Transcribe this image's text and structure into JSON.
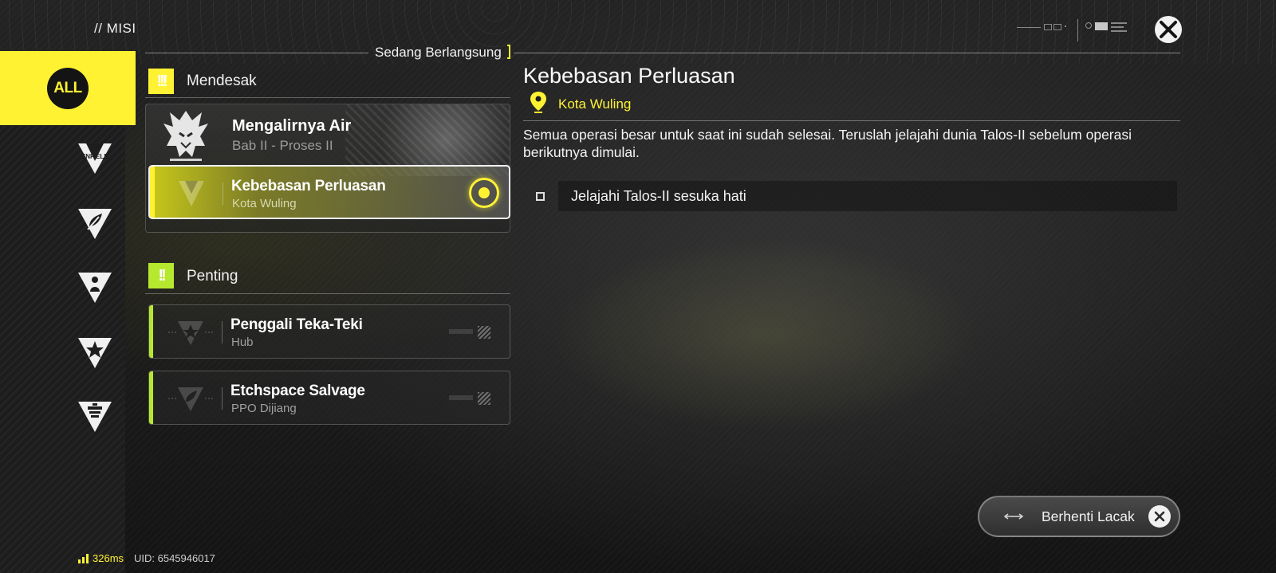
{
  "header": {
    "title": "// MISI",
    "close_icon": "close-x-icon"
  },
  "sidebar": {
    "items": [
      {
        "name": "all",
        "label": "ALL",
        "active": true
      },
      {
        "name": "enfield",
        "label": "ENFIELD",
        "icon": "enfield-v-icon"
      },
      {
        "name": "leaf",
        "icon": "leaf-triangle-icon"
      },
      {
        "name": "person",
        "icon": "person-triangle-icon"
      },
      {
        "name": "star",
        "icon": "star-triangle-icon"
      },
      {
        "name": "list",
        "icon": "list-triangle-icon"
      }
    ]
  },
  "tab": {
    "label": "Sedang Berlangsung"
  },
  "groups": [
    {
      "title": "Mendesak",
      "badge": "!!!",
      "color": "#fff233",
      "missions": [
        {
          "title": "Mengalirnya Air",
          "subtitle": "Bab II - Proses II",
          "featured": true
        },
        {
          "title": "Kebebasan Perluasan",
          "subtitle": "Kota Wuling",
          "selected": true,
          "tracking": true
        }
      ]
    },
    {
      "title": "Penting",
      "badge": "!!",
      "color": "#b7e830",
      "missions": [
        {
          "title": "Penggali Teka-Teki",
          "subtitle": "Hub"
        },
        {
          "title": "Etchspace Salvage",
          "subtitle": "PPO Dijiang"
        }
      ]
    }
  ],
  "detail": {
    "title": "Kebebasan Perluasan",
    "location": "Kota Wuling",
    "location_icon": "map-pin-icon",
    "description": "Semua operasi besar untuk saat ini sudah selesai. Teruslah jelajahi dunia Talos-II sebelum operasi berikutnya dimulai.",
    "objectives": [
      {
        "text": "Jelajahi Talos-II sesuka hati"
      }
    ]
  },
  "stop_tracking": {
    "label": "Berhenti Lacak"
  },
  "footer": {
    "ping": "326ms",
    "uid": "UID: 6545946017"
  },
  "colors": {
    "accent": "#fff233",
    "accent_green": "#b7e830"
  }
}
